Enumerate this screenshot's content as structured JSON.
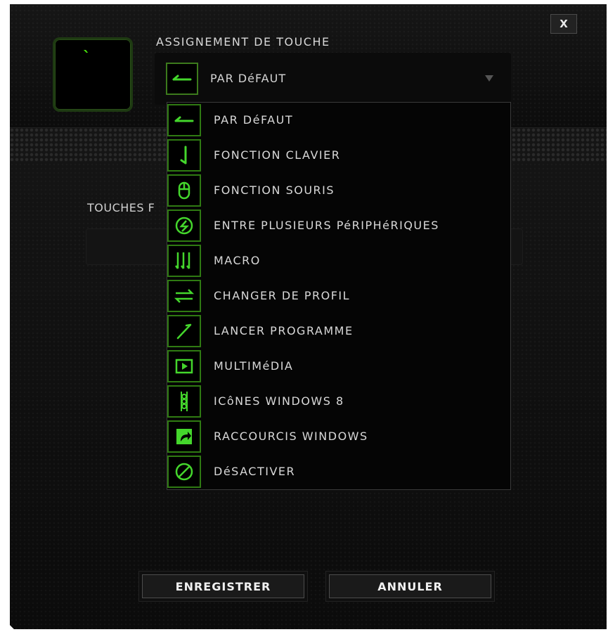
{
  "dialog": {
    "close_label": "X",
    "key_char": "`",
    "section_title": "ASSIGNEMENT DE TOUCHE",
    "dropdown": {
      "selected": "PAR DéFAUT",
      "icon": "default-arrow-icon"
    },
    "touches_label": "TOUCHES F",
    "menu": [
      {
        "label": "PAR DéFAUT",
        "icon": "default-arrow-icon"
      },
      {
        "label": "FONCTION CLAVIER",
        "icon": "keyboard-function-icon"
      },
      {
        "label": "FONCTION SOURIS",
        "icon": "mouse-icon"
      },
      {
        "label": "ENTRE PLUSIEURS PéRIPHéRIQUES",
        "icon": "inter-device-icon"
      },
      {
        "label": "MACRO",
        "icon": "macro-icon"
      },
      {
        "label": "CHANGER DE PROFIL",
        "icon": "switch-profile-icon"
      },
      {
        "label": "LANCER PROGRAMME",
        "icon": "launch-program-icon"
      },
      {
        "label": "MULTIMéDIA",
        "icon": "multimedia-icon"
      },
      {
        "label": "ICôNES WINDOWS 8",
        "icon": "windows8-charms-icon"
      },
      {
        "label": "RACCOURCIS WINDOWS",
        "icon": "windows-shortcut-icon"
      },
      {
        "label": "DéSACTIVER",
        "icon": "disable-icon"
      }
    ],
    "buttons": {
      "save": "ENREGISTRER",
      "cancel": "ANNULER"
    }
  },
  "colors": {
    "accent": "#44d62c",
    "background": "#0a0a0a",
    "icon_border": "#2f7a12"
  }
}
